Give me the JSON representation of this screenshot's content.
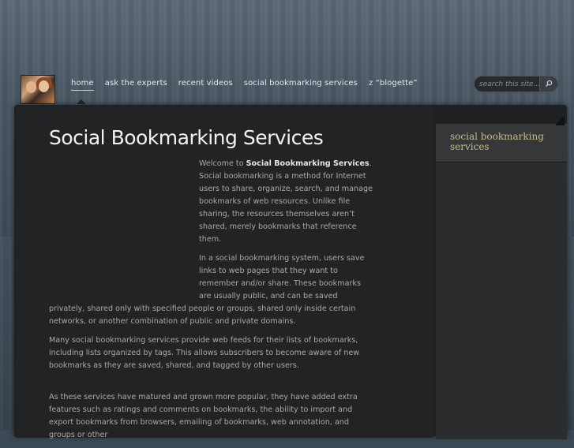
{
  "nav": {
    "items": [
      {
        "label": "home",
        "active": true
      },
      {
        "label": "ask the experts"
      },
      {
        "label": "recent videos"
      },
      {
        "label": "social bookmarking services"
      },
      {
        "label": "z “blogette”"
      }
    ]
  },
  "search": {
    "placeholder": "search this site..."
  },
  "page": {
    "title": "Social Bookmarking Services",
    "intro_lead": "Welcome to ",
    "intro_bold": "Social Bookmarking Services",
    "intro_rest": ". Social bookmarking is a method for Internet users to share, organize, search, and manage bookmarks of web resources. Unlike file sharing, the resources themselves aren’t shared, merely bookmarks that reference them.",
    "paragraph2": "In a social bookmarking system, users save links to web pages that they want to remember and/or share. These bookmarks are usually public, and can be saved privately, shared only with specified people or groups, shared only inside certain networks, or another combination of public and private domains.",
    "paragraph3": "Many social bookmarking services provide web feeds for their lists of bookmarks, including lists organized by tags. This allows subscribers to become aware of new bookmarks as they are saved, shared, and tagged by other users.",
    "paragraph4": "As these services have matured and grown more popular, they have added extra features such as ratings and comments on bookmarks, the ability to import and export bookmarks from browsers, emailing of bookmarks, web annotation, and groups or other"
  },
  "sidebar": {
    "heading": "social bookmarking services"
  },
  "colors": {
    "background": "#3c4a55",
    "panel": "#222324",
    "sidebar_heading": "#c7bd8a"
  }
}
